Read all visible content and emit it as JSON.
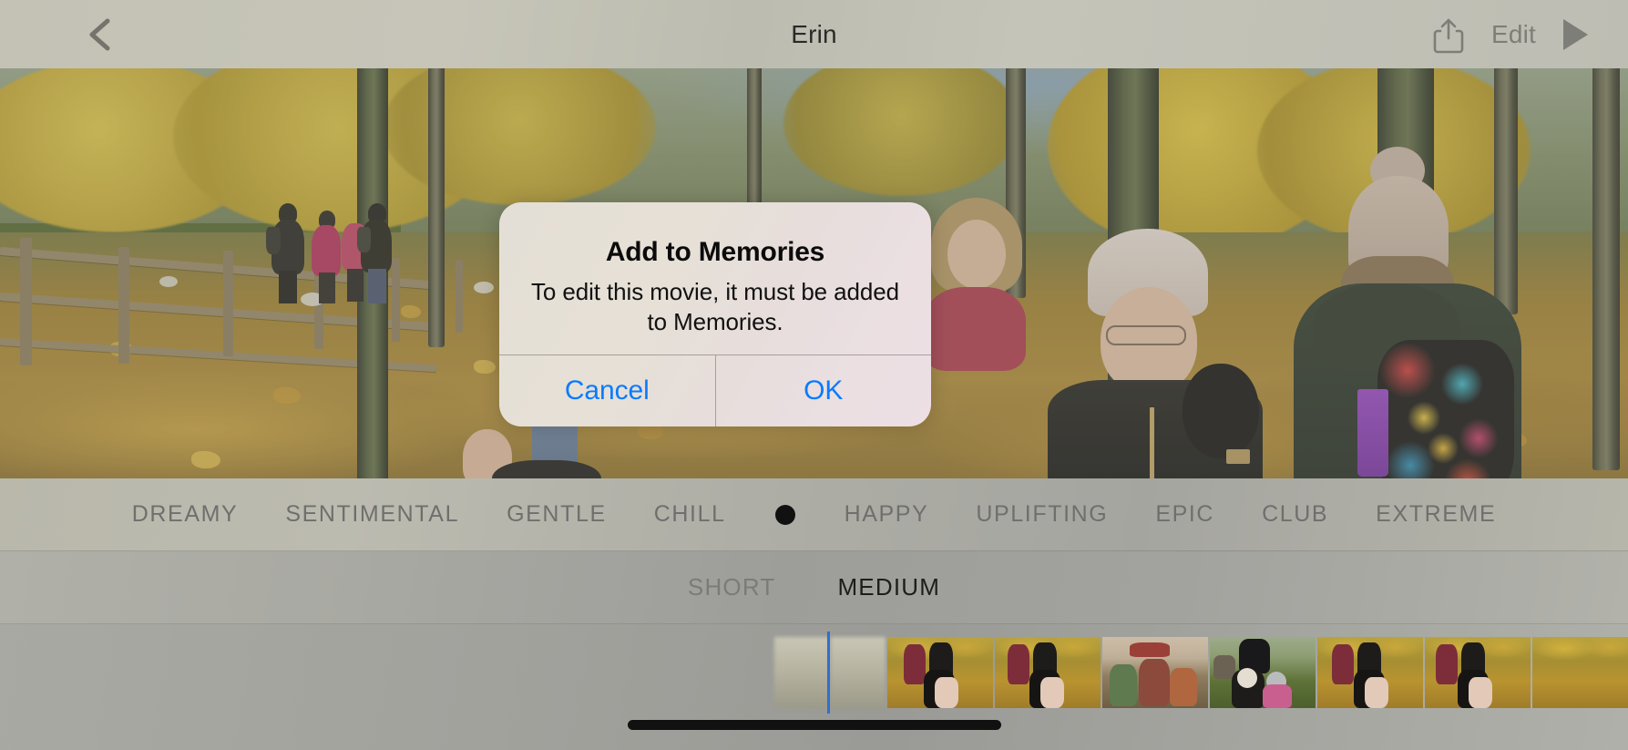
{
  "nav": {
    "back_icon": "chevron-left-icon",
    "title": "Erin",
    "share_icon": "share-icon",
    "edit_label": "Edit",
    "play_icon": "play-icon"
  },
  "alert": {
    "title": "Add to Memories",
    "message": "To edit this movie, it must be added to Memories.",
    "cancel_label": "Cancel",
    "ok_label": "OK",
    "button_color": "#0a7bff"
  },
  "mood_strip": {
    "items": [
      {
        "label": "DREAMY",
        "selected": false
      },
      {
        "label": "SENTIMENTAL",
        "selected": false
      },
      {
        "label": "GENTLE",
        "selected": false
      },
      {
        "label": "CHILL",
        "selected": false
      },
      {
        "label": "HAPPY",
        "selected": false
      },
      {
        "label": "UPLIFTING",
        "selected": false
      },
      {
        "label": "EPIC",
        "selected": false
      },
      {
        "label": "CLUB",
        "selected": false
      },
      {
        "label": "EXTREME",
        "selected": false
      }
    ],
    "selector_dot": "selected-mood-dot",
    "selector_dot_color": "#111111"
  },
  "duration_strip": {
    "items": [
      {
        "label": "SHORT",
        "selected": false
      },
      {
        "label": "MEDIUM",
        "selected": true
      }
    ]
  },
  "filmstrip": {
    "playhead_color": "#2f6fd0",
    "frames": [
      {
        "scene": "autumn-woodland-blurred"
      },
      {
        "scene": "autumn-woodland-blurred"
      },
      {
        "scene": "children-autumn-leaves"
      },
      {
        "scene": "children-autumn-leaves"
      },
      {
        "scene": "tent-craft-stall"
      },
      {
        "scene": "children-field-green"
      },
      {
        "scene": "children-autumn-leaves"
      },
      {
        "scene": "children-autumn-leaves"
      }
    ]
  },
  "preview": {
    "scene": "autumn-woodland-walk-with-people"
  },
  "home_indicator": "home-indicator"
}
